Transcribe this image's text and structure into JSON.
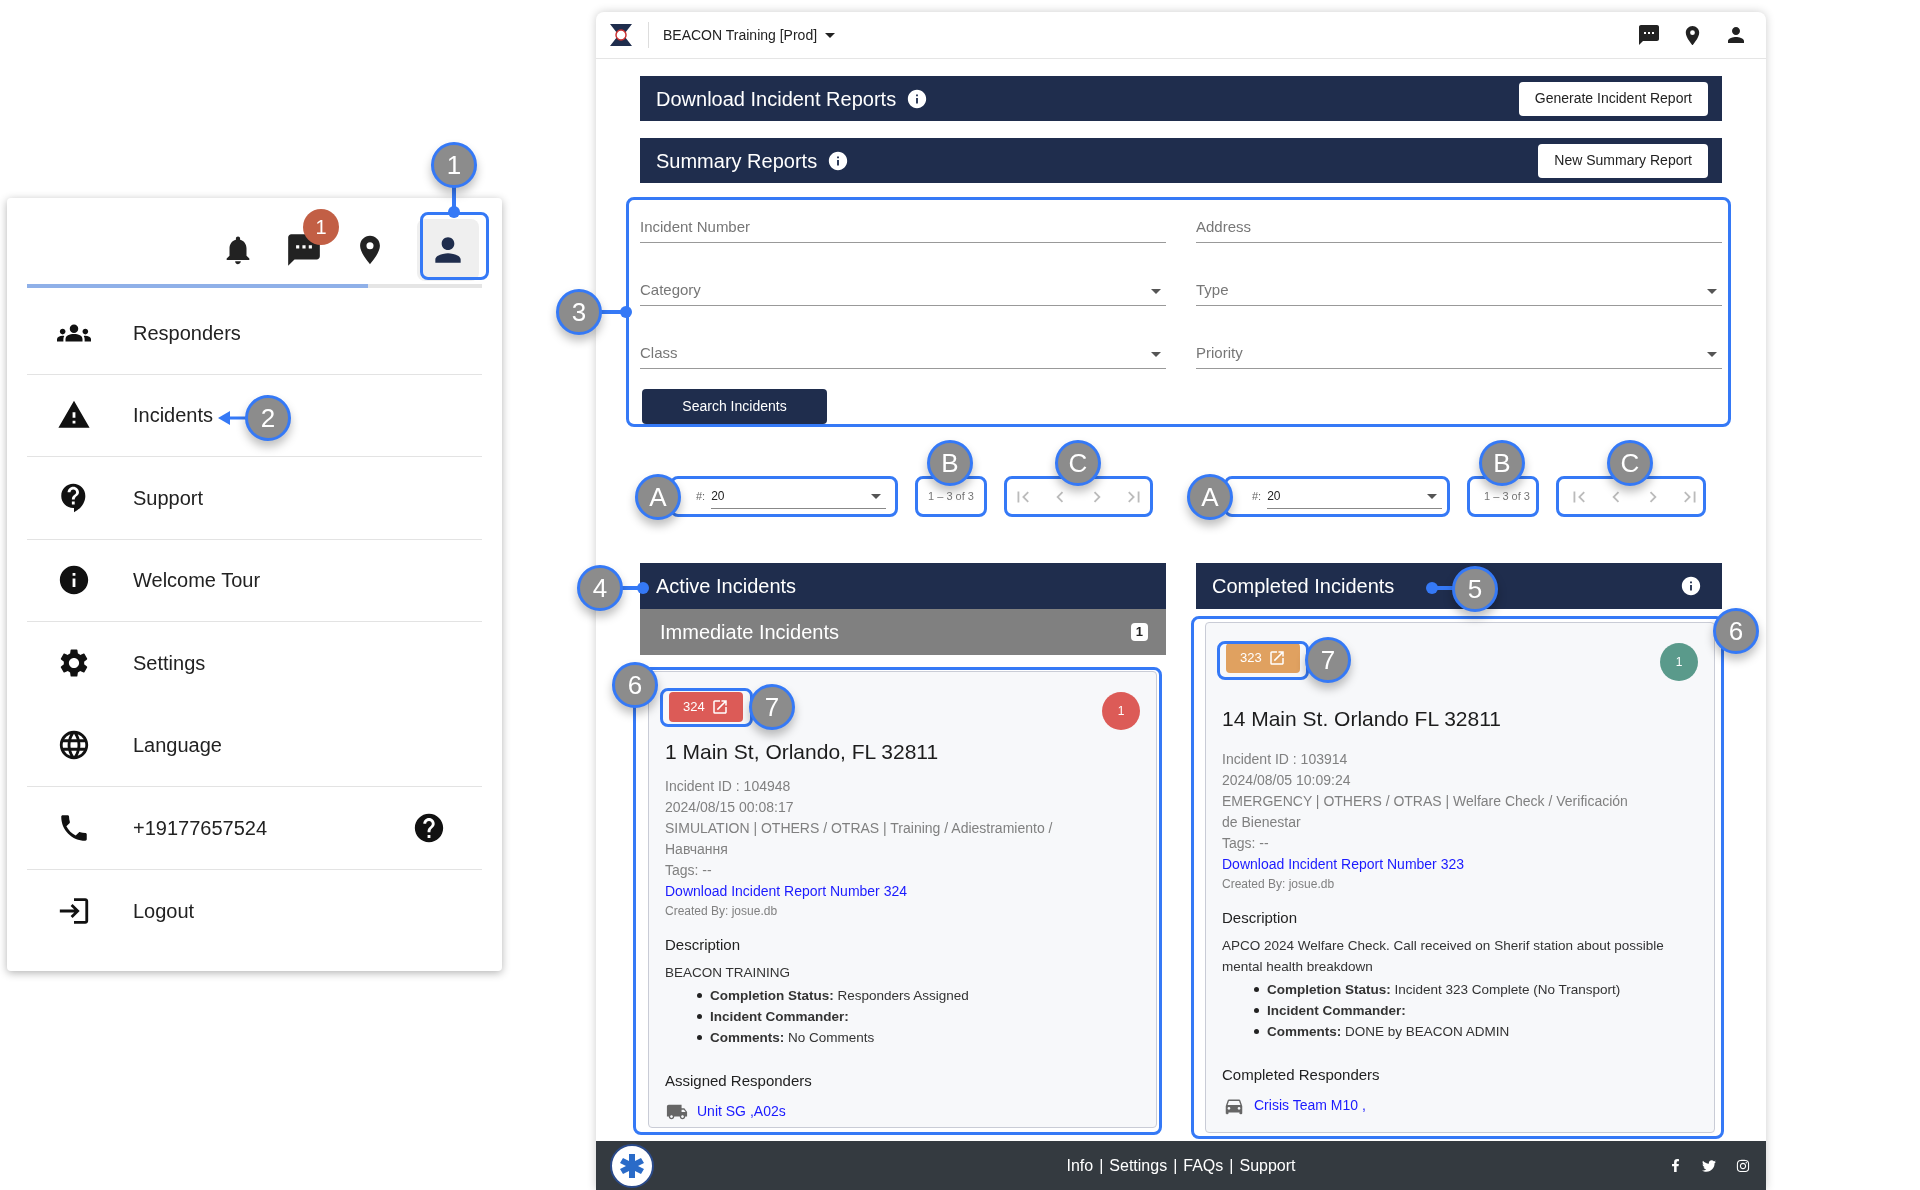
{
  "menu_panel": {
    "message_badge": "1",
    "items": [
      {
        "label": "Responders"
      },
      {
        "label": "Incidents"
      },
      {
        "label": "Support"
      },
      {
        "label": "Welcome Tour"
      },
      {
        "label": "Settings"
      },
      {
        "label": "Language"
      },
      {
        "label": "+19177657524"
      },
      {
        "label": "Logout"
      }
    ]
  },
  "app": {
    "workspace": "BEACON Training [Prod]",
    "sections": [
      {
        "title": "Download Incident Reports",
        "button": "Generate Incident Report"
      },
      {
        "title": "Summary Reports",
        "button": "New Summary Report"
      }
    ],
    "filters": [
      {
        "label": "Incident Number",
        "kind": "text"
      },
      {
        "label": "Address",
        "kind": "text"
      },
      {
        "label": "Category",
        "kind": "select"
      },
      {
        "label": "Type",
        "kind": "select"
      },
      {
        "label": "Class",
        "kind": "select"
      },
      {
        "label": "Priority",
        "kind": "select"
      }
    ],
    "search_button": "Search Incidents",
    "paginators": [
      {
        "size_label": "#:",
        "size": "20",
        "range": "1 – 3 of 3"
      },
      {
        "size_label": "#:",
        "size": "20",
        "range": "1 – 3 of 3"
      }
    ],
    "active": {
      "title": "Active Incidents",
      "group": {
        "title": "Immediate Incidents",
        "count": "1"
      },
      "card": {
        "number": "324",
        "color": "#dc5b57",
        "priority": {
          "text": "1",
          "color": "#dc5b57"
        },
        "address": "1 Main St, Orlando, FL 32811",
        "lines": [
          "Incident ID : 104948",
          "2024/08/15 00:08:17",
          "SIMULATION | OTHERS / OTRAS | Training / Adiestramiento / Навчання",
          "Tags: --"
        ],
        "link": "Download Incident Report Number 324",
        "created_by": "Created By: josue.db",
        "description_title": "Description",
        "description": "BEACON TRAINING",
        "details": [
          "**Completion Status:** Responders Assigned",
          "**Incident Commander:**",
          "**Comments:** No Comments"
        ],
        "responders_title": "Assigned Responders",
        "responders": "Unit SG ,A02s"
      }
    },
    "completed": {
      "title": "Completed Incidents",
      "card": {
        "number": "323",
        "color": "#e0a160",
        "priority": {
          "text": "1",
          "color": "#5a9a8b"
        },
        "address": "14 Main St. Orlando FL 32811",
        "lines": [
          "Incident ID : 103914",
          "2024/08/05 10:09:24",
          "EMERGENCY | OTHERS / OTRAS | Welfare Check / Verificación de Bienestar",
          "Tags: --"
        ],
        "link": "Download Incident Report Number 323",
        "created_by": "Created By: josue.db",
        "description_title": "Description",
        "description": "APCO 2024 Welfare Check. Call received on Sherif station about possible mental health breakdown",
        "details": [
          "**Completion Status:** Incident 323 Complete (No Transport)",
          "**Incident Commander:**",
          "**Comments:** DONE by BEACON ADMIN"
        ],
        "responders_title": "Completed Responders",
        "responders": "Crisis Team M10 ,"
      }
    },
    "footer": {
      "links": [
        "Info",
        "Settings",
        "FAQs",
        "Support"
      ],
      "separator": "|"
    }
  },
  "callouts": [
    {
      "label": "1"
    },
    {
      "label": "2"
    },
    {
      "label": "3"
    },
    {
      "label": "A"
    },
    {
      "label": "B"
    },
    {
      "label": "C"
    },
    {
      "label": "A"
    },
    {
      "label": "B"
    },
    {
      "label": "C"
    },
    {
      "label": "4"
    },
    {
      "label": "5"
    },
    {
      "label": "6"
    },
    {
      "label": "7"
    },
    {
      "label": "6"
    },
    {
      "label": "7"
    }
  ]
}
